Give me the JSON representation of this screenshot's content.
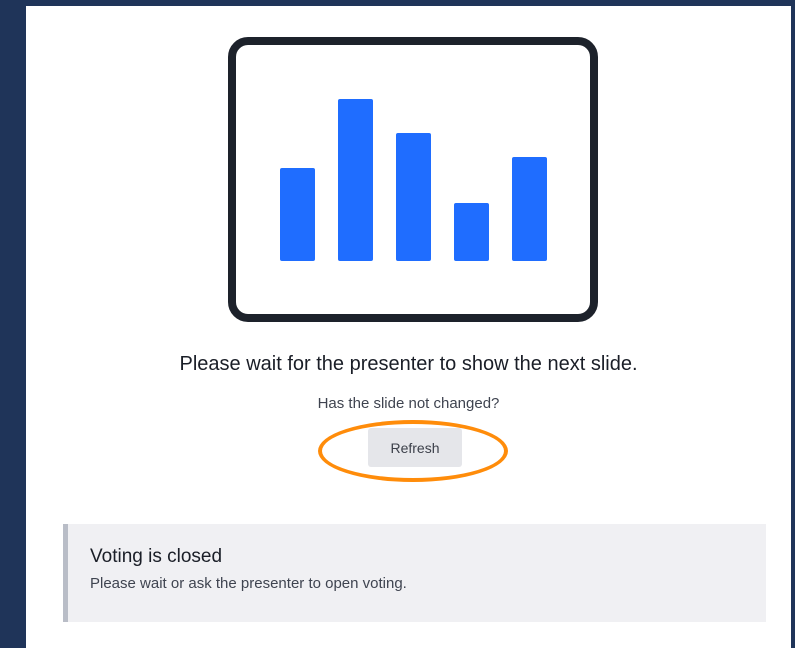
{
  "waiting": {
    "headline": "Please wait for the presenter to show the next slide.",
    "subtext": "Has the slide not changed?",
    "refresh_label": "Refresh"
  },
  "notice": {
    "title": "Voting is closed",
    "body": "Please wait or ask the presenter to open voting."
  },
  "colors": {
    "bar": "#1f6dff",
    "device_outline": "#1d222b",
    "highlight": "#ff8c0a",
    "page_border": "#1f3459"
  },
  "icons": {
    "illustration": "presentation-bar-chart-icon"
  }
}
